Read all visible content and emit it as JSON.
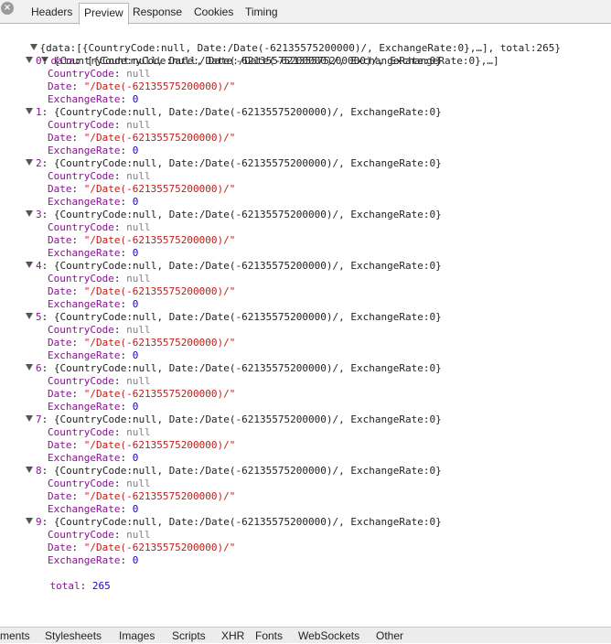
{
  "tabs": {
    "close_icon": "×",
    "headers": "Headers",
    "preview": "Preview",
    "response": "Response",
    "cookies": "Cookies",
    "timing": "Timing"
  },
  "root": {
    "summary": "{data:[{CountryCode:null, Date:/Date(-62135575200000)/, ExchangeRate:0},…], total:265}",
    "data_label": "data",
    "data_summary": "[{CountryCode:null, Date:/Date(-62135575200000)/, ExchangeRate:0},…]",
    "items": [
      {
        "index": "0",
        "summary": "{CountryCode:null, Date:/Date(-62135575200000)/, ExchangeRate:0}",
        "country_key": "CountryCode",
        "country_val": "null",
        "date_key": "Date",
        "date_val": "\"/Date(-62135575200000)/\"",
        "rate_key": "ExchangeRate",
        "rate_val": "0"
      },
      {
        "index": "1",
        "summary": "{CountryCode:null, Date:/Date(-62135575200000)/, ExchangeRate:0}",
        "country_key": "CountryCode",
        "country_val": "null",
        "date_key": "Date",
        "date_val": "\"/Date(-62135575200000)/\"",
        "rate_key": "ExchangeRate",
        "rate_val": "0"
      },
      {
        "index": "2",
        "summary": "{CountryCode:null, Date:/Date(-62135575200000)/, ExchangeRate:0}",
        "country_key": "CountryCode",
        "country_val": "null",
        "date_key": "Date",
        "date_val": "\"/Date(-62135575200000)/\"",
        "rate_key": "ExchangeRate",
        "rate_val": "0"
      },
      {
        "index": "3",
        "summary": "{CountryCode:null, Date:/Date(-62135575200000)/, ExchangeRate:0}",
        "country_key": "CountryCode",
        "country_val": "null",
        "date_key": "Date",
        "date_val": "\"/Date(-62135575200000)/\"",
        "rate_key": "ExchangeRate",
        "rate_val": "0"
      },
      {
        "index": "4",
        "summary": "{CountryCode:null, Date:/Date(-62135575200000)/, ExchangeRate:0}",
        "country_key": "CountryCode",
        "country_val": "null",
        "date_key": "Date",
        "date_val": "\"/Date(-62135575200000)/\"",
        "rate_key": "ExchangeRate",
        "rate_val": "0"
      },
      {
        "index": "5",
        "summary": "{CountryCode:null, Date:/Date(-62135575200000)/, ExchangeRate:0}",
        "country_key": "CountryCode",
        "country_val": "null",
        "date_key": "Date",
        "date_val": "\"/Date(-62135575200000)/\"",
        "rate_key": "ExchangeRate",
        "rate_val": "0"
      },
      {
        "index": "6",
        "summary": "{CountryCode:null, Date:/Date(-62135575200000)/, ExchangeRate:0}",
        "country_key": "CountryCode",
        "country_val": "null",
        "date_key": "Date",
        "date_val": "\"/Date(-62135575200000)/\"",
        "rate_key": "ExchangeRate",
        "rate_val": "0"
      },
      {
        "index": "7",
        "summary": "{CountryCode:null, Date:/Date(-62135575200000)/, ExchangeRate:0}",
        "country_key": "CountryCode",
        "country_val": "null",
        "date_key": "Date",
        "date_val": "\"/Date(-62135575200000)/\"",
        "rate_key": "ExchangeRate",
        "rate_val": "0"
      },
      {
        "index": "8",
        "summary": "{CountryCode:null, Date:/Date(-62135575200000)/, ExchangeRate:0}",
        "country_key": "CountryCode",
        "country_val": "null",
        "date_key": "Date",
        "date_val": "\"/Date(-62135575200000)/\"",
        "rate_key": "ExchangeRate",
        "rate_val": "0"
      },
      {
        "index": "9",
        "summary": "{CountryCode:null, Date:/Date(-62135575200000)/, ExchangeRate:0}",
        "country_key": "CountryCode",
        "country_val": "null",
        "date_key": "Date",
        "date_val": "\"/Date(-62135575200000)/\"",
        "rate_key": "ExchangeRate",
        "rate_val": "0"
      }
    ],
    "total_key": "total",
    "total_val": "265"
  },
  "bottom_tabs": {
    "elements": "ments",
    "stylesheets": "Stylesheets",
    "images": "Images",
    "scripts": "Scripts",
    "xhr": "XHR",
    "fonts": "Fonts",
    "websockets": "WebSockets",
    "other": "Other"
  },
  "colors": {
    "key": "#881391",
    "null": "#808080",
    "string": "#c41a16",
    "number": "#1c00cf"
  }
}
